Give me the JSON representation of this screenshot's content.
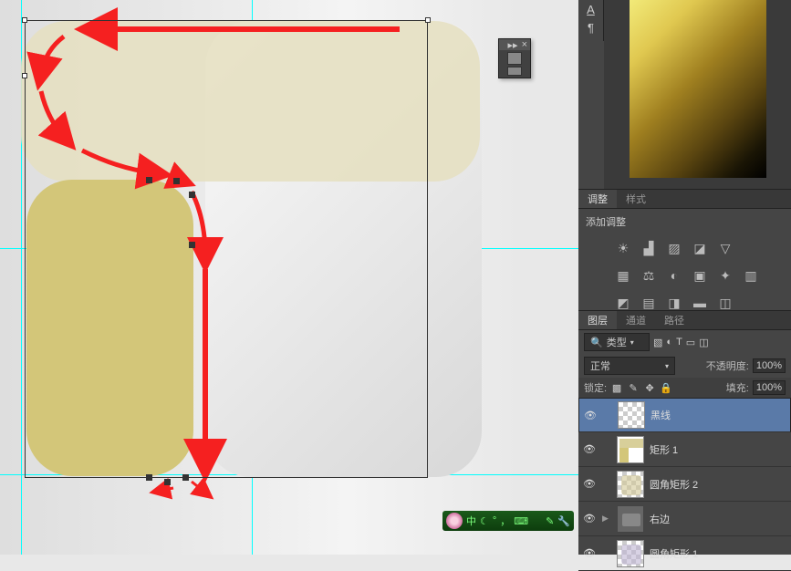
{
  "panels": {
    "adjustments": {
      "tab1": "调整",
      "tab2": "样式",
      "title": "添加调整"
    },
    "layers": {
      "tab1": "图层",
      "tab2": "通道",
      "tab3": "路径",
      "filter_label": "类型",
      "blend_mode": "正常",
      "opacity_label": "不透明度:",
      "opacity_value": "100%",
      "lock_label": "锁定:",
      "fill_label": "填充:",
      "fill_value": "100%",
      "items": [
        {
          "name": "黑线",
          "selected": true,
          "expandable": false
        },
        {
          "name": "矩形 1",
          "selected": false,
          "expandable": false
        },
        {
          "name": "圆角矩形 2",
          "selected": false,
          "expandable": false
        },
        {
          "name": "右边",
          "selected": false,
          "expandable": true,
          "folder": true
        },
        {
          "name": "圆角矩形 1",
          "selected": false,
          "expandable": false
        }
      ]
    }
  },
  "ime": {
    "text": "中 ",
    "moon": "☾",
    "dot": "°",
    "punct": "，"
  },
  "tool_icons": {
    "a": "A",
    "para": "¶"
  }
}
